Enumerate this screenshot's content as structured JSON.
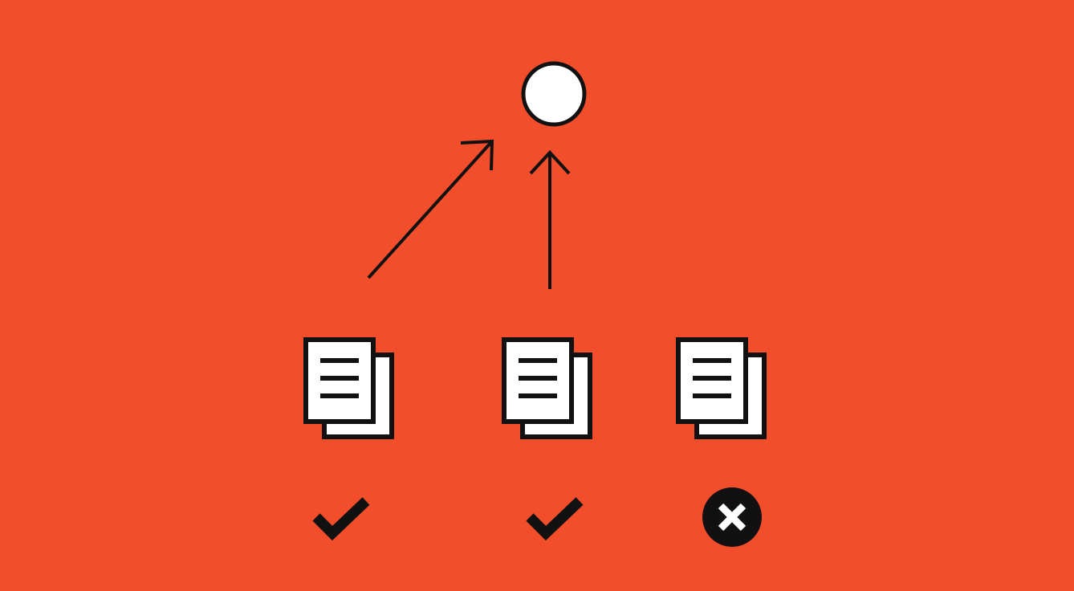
{
  "colors": {
    "background": "#F24E2C",
    "ink": "#111111",
    "paper": "#FFFFFF"
  },
  "diagram": {
    "target": {
      "icon": "circle-node-icon"
    },
    "documents": [
      {
        "icon": "document-stack-icon",
        "status": "accepted",
        "status_icon": "check-icon",
        "links_to_target": true
      },
      {
        "icon": "document-stack-icon",
        "status": "accepted",
        "status_icon": "check-icon",
        "links_to_target": true
      },
      {
        "icon": "document-stack-icon",
        "status": "rejected",
        "status_icon": "x-circle-icon",
        "links_to_target": false
      }
    ]
  }
}
